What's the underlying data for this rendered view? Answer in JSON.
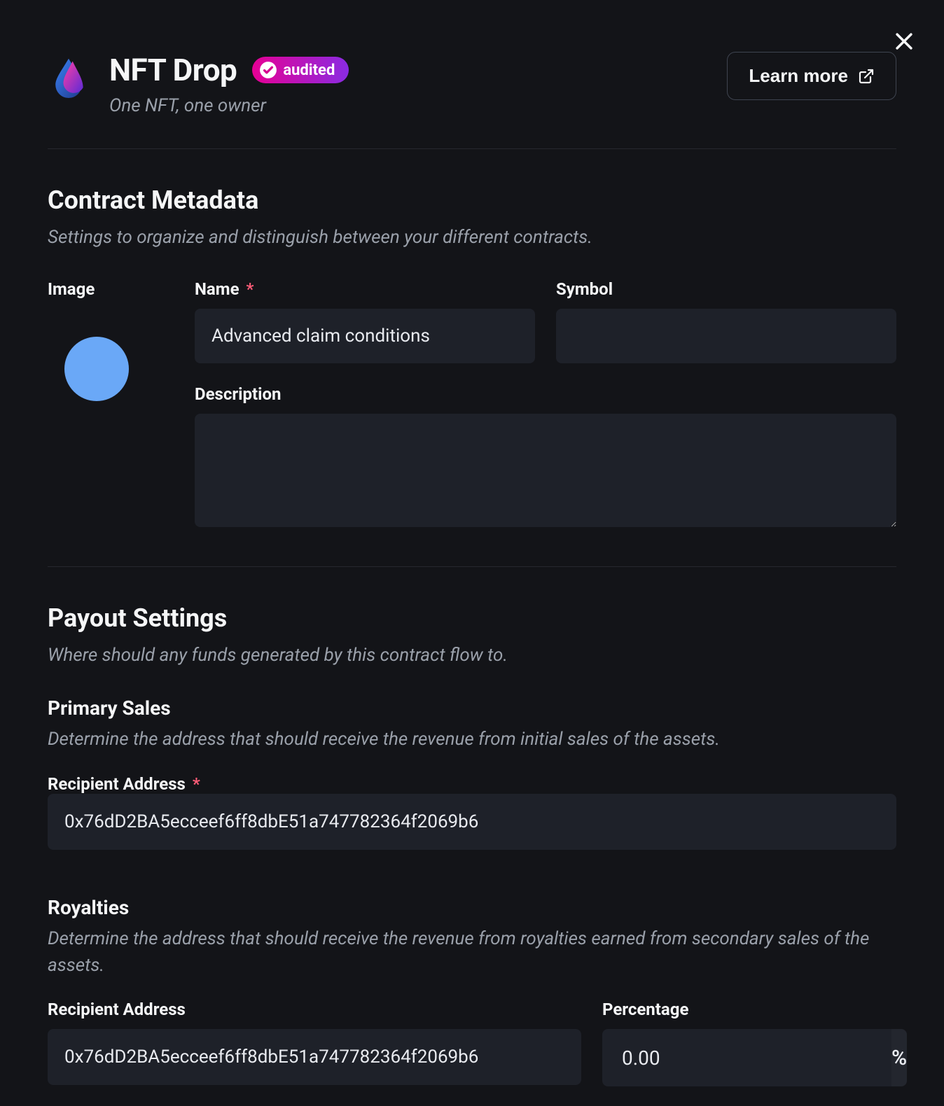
{
  "header": {
    "title": "NFT Drop",
    "audited_label": "audited",
    "subtitle": "One NFT, one owner",
    "learn_more_label": "Learn more"
  },
  "metadata": {
    "section_title": "Contract Metadata",
    "section_desc": "Settings to organize and distinguish between your different contracts.",
    "image_label": "Image",
    "name_label": "Name",
    "name_required": "*",
    "name_value": "Advanced claim conditions",
    "symbol_label": "Symbol",
    "symbol_value": "",
    "description_label": "Description",
    "description_value": ""
  },
  "payout": {
    "section_title": "Payout Settings",
    "section_desc": "Where should any funds generated by this contract flow to.",
    "primary": {
      "heading": "Primary Sales",
      "desc": "Determine the address that should receive the revenue from initial sales of the assets.",
      "recipient_label": "Recipient Address",
      "recipient_required": "*",
      "recipient_value": "0x76dD2BA5ecceef6ff8dbE51a747782364f2069b6"
    },
    "royalties": {
      "heading": "Royalties",
      "desc": "Determine the address that should receive the revenue from royalties earned from secondary sales of the assets.",
      "recipient_label": "Recipient Address",
      "recipient_value": "0x76dD2BA5ecceef6ff8dbE51a747782364f2069b6",
      "percentage_label": "Percentage",
      "percentage_value": "0.00",
      "percentage_suffix": "%"
    }
  }
}
